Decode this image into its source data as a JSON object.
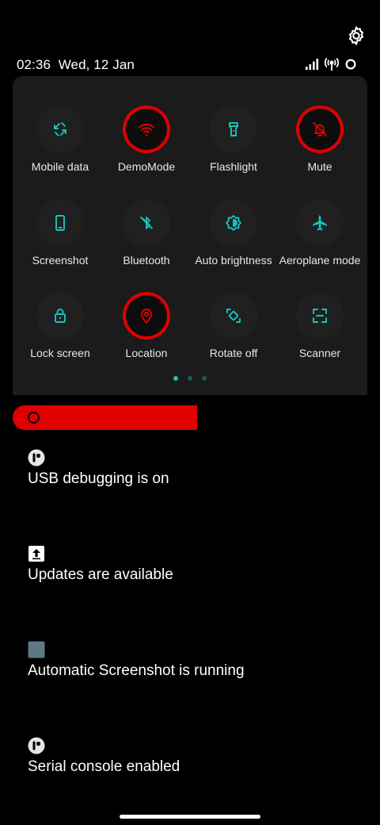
{
  "status_bar": {
    "time": "02:36",
    "date": "Wed, 12 Jan"
  },
  "quick_settings": {
    "accent_color": "#16c5bd",
    "highlight_color": "#e00000",
    "tiles": [
      {
        "label": "Mobile data",
        "icon": "mobile-data-icon",
        "highlighted": false
      },
      {
        "label": "DemoMode",
        "icon": "wifi-icon",
        "highlighted": true
      },
      {
        "label": "Flashlight",
        "icon": "flashlight-icon",
        "highlighted": false
      },
      {
        "label": "Mute",
        "icon": "bell-off-icon",
        "highlighted": true
      },
      {
        "label": "Screenshot",
        "icon": "phone-icon",
        "highlighted": false
      },
      {
        "label": "Bluetooth",
        "icon": "bluetooth-off-icon",
        "highlighted": false
      },
      {
        "label": "Auto brightness",
        "icon": "brightness-icon",
        "highlighted": false
      },
      {
        "label": "Aeroplane mode",
        "icon": "airplane-icon",
        "highlighted": false
      },
      {
        "label": "Lock screen",
        "icon": "lock-icon",
        "highlighted": false
      },
      {
        "label": "Location",
        "icon": "location-pin-icon",
        "highlighted": true
      },
      {
        "label": "Rotate off",
        "icon": "rotate-icon",
        "highlighted": false
      },
      {
        "label": "Scanner",
        "icon": "scanner-icon",
        "highlighted": false
      }
    ],
    "pages": 3,
    "current_page": 1
  },
  "notifications": [
    {
      "text": "USB debugging is on",
      "icon": "android-debug-icon"
    },
    {
      "text": "Updates are available",
      "icon": "update-arrow-icon"
    },
    {
      "text": "Automatic Screenshot is running",
      "icon": "app-square-icon"
    },
    {
      "text": "Serial console enabled",
      "icon": "android-debug-icon"
    }
  ]
}
